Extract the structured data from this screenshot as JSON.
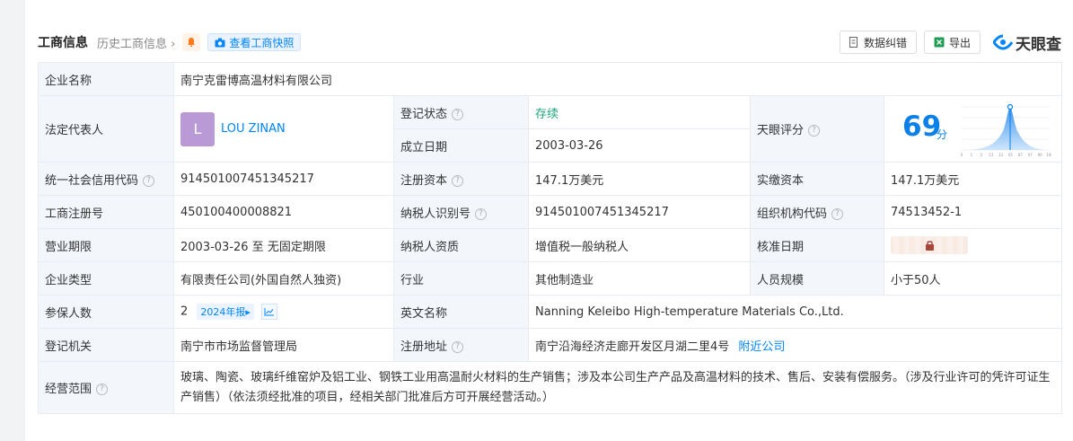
{
  "header": {
    "title": "工商信息",
    "history": "历史工商信息",
    "history_chevron": "›",
    "snapshot": "查看工商快照",
    "correct_btn": "数据纠错",
    "export_btn": "导出",
    "logo": "天眼查"
  },
  "rows": {
    "company_name_label": "企业名称",
    "company_name": "南宁克雷博高温材料有限公司",
    "legal_rep_label": "法定代表人",
    "avatar_letter": "L",
    "legal_rep": "LOU ZINAN",
    "reg_status_label": "登记状态",
    "reg_status": "存续",
    "est_date_label": "成立日期",
    "est_date": "2003-03-26",
    "score_label": "天眼评分",
    "score": "69",
    "score_unit": "分",
    "credit_code_label": "统一社会信用代码",
    "credit_code": "914501007451345217",
    "reg_capital_label": "注册资本",
    "reg_capital": "147.1万美元",
    "paid_capital_label": "实缴资本",
    "paid_capital": "147.1万美元",
    "reg_no_label": "工商注册号",
    "reg_no": "450100400008821",
    "taxpayer_id_label": "纳税人识别号",
    "taxpayer_id": "914501007451345217",
    "org_code_label": "组织机构代码",
    "org_code": "74513452-1",
    "term_label": "营业期限",
    "term": "2003-03-26 至 无固定期限",
    "taxpayer_qual_label": "纳税人资质",
    "taxpayer_qual": "增值税一般纳税人",
    "approve_date_label": "核准日期",
    "type_label": "企业类型",
    "type": "有限责任公司(外国自然人独资)",
    "industry_label": "行业",
    "industry": "其他制造业",
    "staff_label": "人员规模",
    "staff": "小于50人",
    "insured_label": "参保人数",
    "insured": "2",
    "insured_badge": "2024年报▸",
    "en_name_label": "英文名称",
    "en_name": "Nanning Keleibo High-temperature Materials Co.,Ltd.",
    "authority_label": "登记机关",
    "authority": "南宁市市场监督管理局",
    "address_label": "注册地址",
    "address": "南宁沿海经济走廊开发区月湖二里4号",
    "nearby": "附近公司",
    "scope_label": "经营范围",
    "scope": "玻璃、陶瓷、玻璃纤维窑炉及铝工业、钢铁工业用高温耐火材料的生产销售；涉及本公司生产产品及高温材料的技术、售后、安装有偿服务。（涉及行业许可的凭许可证生产销售）（依法须经批准的项目，经相关部门批准后方可开展经营活动。）"
  },
  "score_chart_ticks": [
    "0",
    "1",
    "3",
    "13",
    "33",
    "65",
    "87",
    "97",
    "99",
    "100"
  ],
  "colors": {
    "accent": "#0084ff",
    "score": "#0b80e8",
    "status_green": "#1fa87a"
  }
}
